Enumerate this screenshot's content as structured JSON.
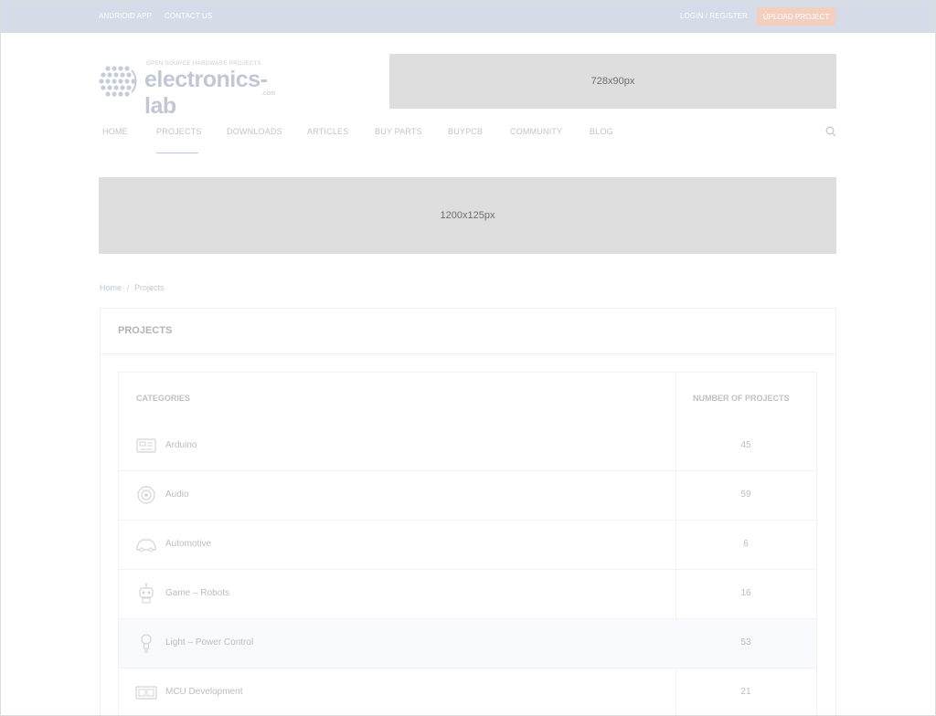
{
  "topbar": {
    "android_app": "ANDRIOID APP",
    "contact_us": "CONTACT US",
    "login_register": "LOGIN / REGISTER",
    "upload_project": "UPLOAD PROJECT"
  },
  "logo": {
    "tagline": "OPEN SOURCE HARDWARE PROJECTS",
    "name": "electronics-lab",
    "suffix": ".com"
  },
  "ads": {
    "top": "728x90px",
    "wide": "1200x125px"
  },
  "nav": {
    "items": [
      "HOME",
      "PROJECTS",
      "DOWNLOADS",
      "ARTICLES",
      "BUY PARTS",
      "BUYPCB",
      "COMMUNITY",
      "BLOG"
    ],
    "active": "PROJECTS"
  },
  "breadcrumb": {
    "home": "Home",
    "separator": "/",
    "current": "Projects"
  },
  "panel": {
    "title": "PROJECTS"
  },
  "table": {
    "headers": {
      "categories": "CATEGORIES",
      "count": "NUMBER OF PROJECTS"
    },
    "rows": [
      {
        "icon": "arduino-board-icon",
        "label": "Arduino",
        "count": "45"
      },
      {
        "icon": "speaker-icon",
        "label": "Audio",
        "count": "59"
      },
      {
        "icon": "car-icon",
        "label": "Automotive",
        "count": "6"
      },
      {
        "icon": "robot-icon",
        "label": "Game – Robots",
        "count": "16"
      },
      {
        "icon": "light-bulb-icon",
        "label": "Light – Power Control",
        "count": "53"
      },
      {
        "icon": "microcontroller-icon",
        "label": "MCU Development",
        "count": "21"
      }
    ]
  },
  "colors": {
    "topbar_bg": "#d5dce8",
    "upload_button_bg": "#f4cfc0",
    "link_blue": "#b9c7e6",
    "ad_bg": "#dedede"
  }
}
